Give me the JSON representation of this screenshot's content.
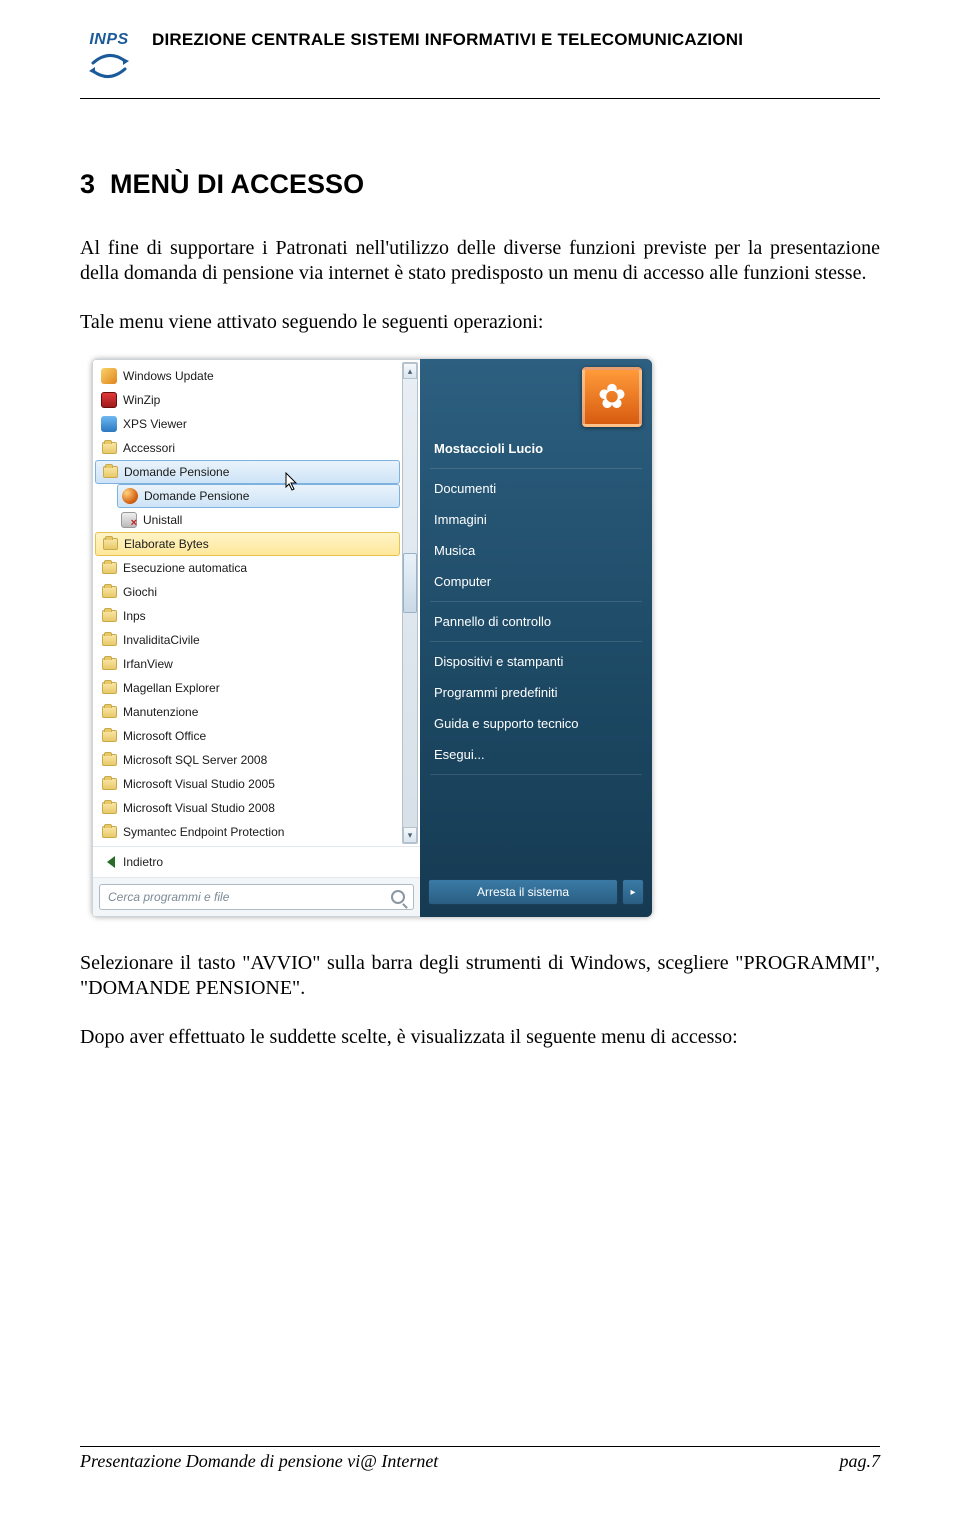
{
  "header": {
    "logo_text": "INPS",
    "title": "DIREZIONE CENTRALE SISTEMI INFORMATIVI E TELECOMUNICAZIONI"
  },
  "section": {
    "number": "3",
    "title": "MENÙ DI ACCESSO"
  },
  "paragraphs": {
    "p1": "Al fine di supportare i Patronati nell'utilizzo delle diverse funzioni previste per la presentazione della domanda di pensione via internet è stato predisposto un menu di accesso alle funzioni stesse.",
    "p2": "Tale menu viene attivato seguendo le seguenti operazioni:",
    "p3": "Selezionare il tasto  \"AVVIO\" sulla barra degli strumenti di Windows, scegliere \"PROGRAMMI\", \"DOMANDE PENSIONE\".",
    "p4": "Dopo aver effettuato le suddette scelte, è visualizzata  il seguente menu di accesso:"
  },
  "start_menu": {
    "left": {
      "items": [
        {
          "label": "Windows Update",
          "icon": "wu",
          "kind": "app"
        },
        {
          "label": "WinZip",
          "icon": "wz",
          "kind": "app"
        },
        {
          "label": "XPS Viewer",
          "icon": "xps",
          "kind": "app"
        },
        {
          "label": "Accessori",
          "icon": "folder",
          "kind": "folder"
        },
        {
          "label": "Domande Pensione",
          "icon": "folder",
          "kind": "folder",
          "state": "selected"
        },
        {
          "label": "Domande Pensione",
          "icon": "dp",
          "kind": "app",
          "child": true,
          "state": "selected"
        },
        {
          "label": "Unistall",
          "icon": "un",
          "kind": "app",
          "child": true
        },
        {
          "label": "Elaborate Bytes",
          "icon": "folder",
          "kind": "folder",
          "state": "hover"
        },
        {
          "label": "Esecuzione automatica",
          "icon": "folder",
          "kind": "folder"
        },
        {
          "label": "Giochi",
          "icon": "folder",
          "kind": "folder"
        },
        {
          "label": "Inps",
          "icon": "folder",
          "kind": "folder"
        },
        {
          "label": "InvaliditaCivile",
          "icon": "folder",
          "kind": "folder"
        },
        {
          "label": "IrfanView",
          "icon": "folder",
          "kind": "folder"
        },
        {
          "label": "Magellan Explorer",
          "icon": "folder",
          "kind": "folder"
        },
        {
          "label": "Manutenzione",
          "icon": "folder",
          "kind": "folder"
        },
        {
          "label": "Microsoft Office",
          "icon": "folder",
          "kind": "folder"
        },
        {
          "label": "Microsoft SQL Server 2008",
          "icon": "folder",
          "kind": "folder"
        },
        {
          "label": "Microsoft Visual Studio 2005",
          "icon": "folder",
          "kind": "folder"
        },
        {
          "label": "Microsoft Visual Studio 2008",
          "icon": "folder",
          "kind": "folder"
        },
        {
          "label": "Symantec Endpoint Protection",
          "icon": "folder",
          "kind": "folder"
        }
      ],
      "back_label": "Indietro",
      "search_placeholder": "Cerca programmi e file"
    },
    "right": {
      "user_name": "Mostaccioli Lucio",
      "items": [
        "Documenti",
        "Immagini",
        "Musica",
        "Computer",
        "Pannello di controllo",
        "Dispositivi e stampanti",
        "Programmi predefiniti",
        "Guida e supporto tecnico",
        "Esegui..."
      ],
      "shutdown_label": "Arresta il sistema"
    }
  },
  "footer": {
    "left": "Presentazione Domande di pensione vi@ Internet",
    "right": "pag.7"
  }
}
